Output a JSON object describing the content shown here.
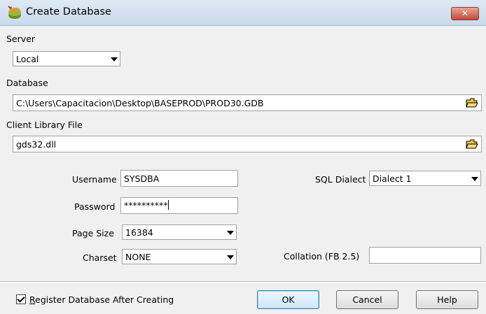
{
  "window": {
    "title": "Create Database",
    "close_label": "✕"
  },
  "server": {
    "label": "Server",
    "value": "Local"
  },
  "database": {
    "label": "Database",
    "value": "C:\\Users\\Capacitacion\\Desktop\\BASEPROD\\PROD30.GDB"
  },
  "client_library": {
    "label": "Client Library File",
    "value": "gds32.dll"
  },
  "username": {
    "label": "Username",
    "value": "SYSDBA"
  },
  "password": {
    "label": "Password",
    "value": "**********"
  },
  "page_size": {
    "label": "Page Size",
    "value": "16384"
  },
  "charset": {
    "label": "Charset",
    "value": "NONE"
  },
  "sql_dialect": {
    "label": "SQL Dialect",
    "value": "Dialect 1"
  },
  "collation": {
    "label": "Collation (FB 2.5)",
    "value": ""
  },
  "register": {
    "label_underlined": "R",
    "label_rest": "egister Database After Creating",
    "checked": true
  },
  "buttons": {
    "ok": "OK",
    "cancel": "Cancel",
    "help": "Help"
  },
  "colors": {
    "title_bar": "#c9d9ec",
    "close_button": "#c2483a",
    "default_button_border": "#3c7fb1"
  }
}
